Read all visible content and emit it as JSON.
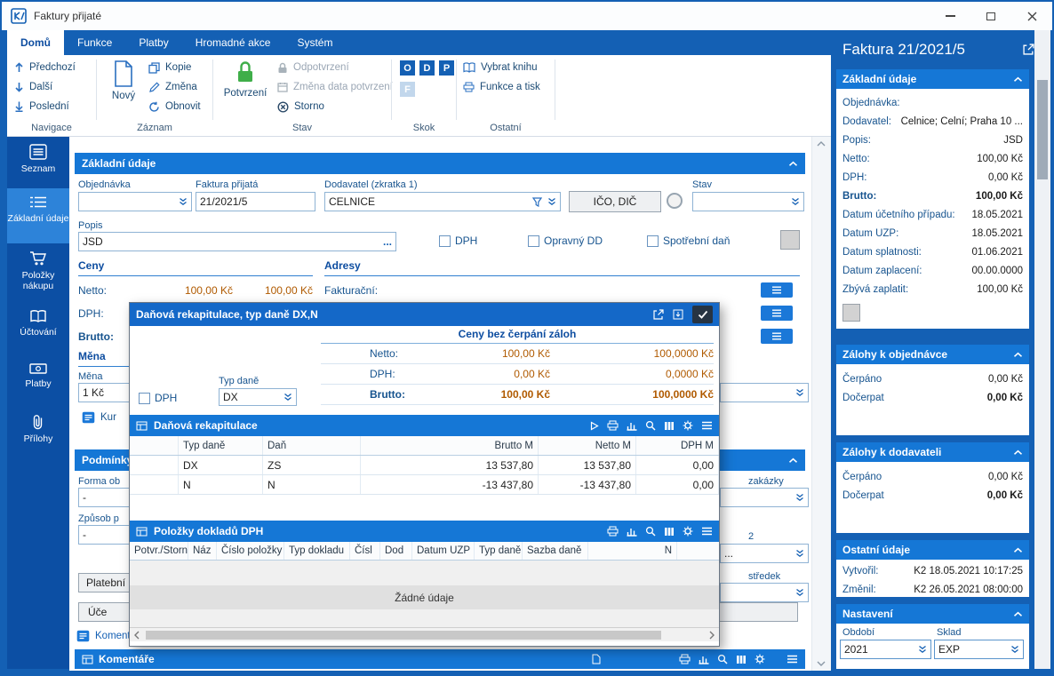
{
  "colors": {
    "accent": "#1460b4",
    "header_bar": "#1577d6",
    "sidebar": "#0c4fa4",
    "sidebar_active": "#2d83d9",
    "currency_text": "#b05a00",
    "confirm_lock_green": "#3fae49"
  },
  "window": {
    "title": "Faktury přijaté"
  },
  "tabs": [
    {
      "label": "Domů"
    },
    {
      "label": "Funkce"
    },
    {
      "label": "Platby"
    },
    {
      "label": "Hromadné akce"
    },
    {
      "label": "Systém"
    }
  ],
  "ribbon": {
    "groups": {
      "navigace": {
        "label": "Navigace",
        "prev": "Předchozí",
        "next": "Další",
        "last": "Poslední"
      },
      "zaznam": {
        "label": "Záznam",
        "new": "Nový",
        "copy": "Kopie",
        "edit": "Změna",
        "refresh": "Obnovit"
      },
      "stav": {
        "label": "Stav",
        "confirm": "Potvrzení",
        "unconfirm": "Odpotvrzení",
        "change_date": "Změna data potvrzení",
        "cancel": "Storno"
      },
      "skok": {
        "label": "Skok",
        "o": "O",
        "d": "D",
        "p": "P",
        "f": "F"
      },
      "ostatni": {
        "label": "Ostatní",
        "select_book": "Vybrat knihu",
        "func_print": "Funkce a tisk"
      }
    }
  },
  "sidebar": {
    "items": [
      {
        "label": "Seznam"
      },
      {
        "label": "Základní údaje"
      },
      {
        "label": "Položky nákupu"
      },
      {
        "label": "Účtování"
      },
      {
        "label": "Platby"
      },
      {
        "label": "Přílohy"
      }
    ]
  },
  "form": {
    "section_title": "Základní údaje",
    "objednavka_label": "Objednávka",
    "faktura_label": "Faktura přijatá",
    "faktura_value": "21/2021/5",
    "dodavatel_label": "Dodavatel (zkratka 1)",
    "dodavatel_value": "CELNICE",
    "ico_dic": "IČO, DIČ",
    "stav_label": "Stav",
    "popis_label": "Popis",
    "popis_value": "JSD",
    "popis_more": "...",
    "chk_dph": "DPH",
    "chk_opravny": "Opravný DD",
    "chk_spotrebni": "Spotřební daň",
    "ceny": "Ceny",
    "adresy": "Adresy",
    "netto_label": "Netto:",
    "netto_v1": "100,00 Kč",
    "netto_v2": "100,00 Kč",
    "fakturacni": "Fakturační:",
    "dph_label": "DPH:",
    "brutto_label": "Brutto:",
    "mena_header": "Měna",
    "mena_label": "Měna",
    "mena_value": "1 Kč",
    "kur": "Kur",
    "podminky": "Podmínky",
    "forma_label": "Forma ob",
    "forma_value": "-",
    "zpusob_label": "Způsob p",
    "zpusob_value": "-",
    "platebni": "Platební p",
    "ucet": "Úče",
    "komentar": "Komentář",
    "komentare": "Komentáře",
    "frag_zakazky": "zakázky",
    "frag_2": "2",
    "frag_stredisko": "středek",
    "frag_dots": "..."
  },
  "modal": {
    "title": "Daňová rekapitulace, typ daně DX,N",
    "summary_title": "Ceny bez čerpání záloh",
    "rows": [
      {
        "label": "Netto:",
        "v1": "100,00 Kč",
        "v2": "100,0000 Kč"
      },
      {
        "label": "DPH:",
        "v1": "0,00 Kč",
        "v2": "0,0000 Kč"
      },
      {
        "label": "Brutto:",
        "v1": "100,00 Kč",
        "v2": "100,0000 Kč"
      }
    ],
    "dph_chk": "DPH",
    "typ_dane_label": "Typ daně",
    "typ_dane_value": "DX",
    "rekap": {
      "title": "Daňová rekapitulace",
      "columns": [
        "Typ daně",
        "Daň",
        "Brutto M",
        "Netto M",
        "DPH M"
      ],
      "rows": [
        [
          "DX",
          "ZS",
          "13 537,80",
          "13 537,80",
          "0,00"
        ],
        [
          "N",
          "N",
          "-13 437,80",
          "-13 437,80",
          "0,00"
        ]
      ]
    },
    "polozky": {
      "title": "Položky dokladů DPH",
      "columns": [
        "Potvr./Storno",
        "Náz",
        "Číslo položky",
        "Typ dokladu",
        "Čísl",
        "Dod",
        "Datum UZP",
        "Typ daně",
        "Sazba daně",
        "N"
      ],
      "empty": "Žádné údaje"
    }
  },
  "panel": {
    "title": "Faktura 21/2021/5",
    "zakladni": {
      "header": "Základní údaje",
      "rows": [
        {
          "label": "Objednávka:",
          "value": ""
        },
        {
          "label": "Dodavatel:",
          "value": "Celnice; Celní; Praha 10 ..."
        },
        {
          "label": "Popis:",
          "value": "JSD"
        },
        {
          "label": "Netto:",
          "value": "100,00 Kč"
        },
        {
          "label": "DPH:",
          "value": "0,00 Kč"
        },
        {
          "label": "Brutto:",
          "value": "100,00 Kč"
        },
        {
          "label": "Datum účetního případu:",
          "value": "18.05.2021"
        },
        {
          "label": "Datum UZP:",
          "value": "18.05.2021"
        },
        {
          "label": "Datum splatnosti:",
          "value": "01.06.2021"
        },
        {
          "label": "Datum zaplacení:",
          "value": "00.00.0000"
        },
        {
          "label": "Zbývá zaplatit:",
          "value": "100,00 Kč"
        }
      ]
    },
    "zalohy_objednavce": {
      "header": "Zálohy k objednávce",
      "cerpano_label": "Čerpáno",
      "cerpano_value": "0,00 Kč",
      "docerpat_label": "Dočerpat",
      "docerpat_value": "0,00 Kč"
    },
    "zalohy_dodavateli": {
      "header": "Zálohy k dodavateli",
      "cerpano_label": "Čerpáno",
      "cerpano_value": "0,00 Kč",
      "docerpat_label": "Dočerpat",
      "docerpat_value": "0,00 Kč"
    },
    "ostatni": {
      "header": "Ostatní údaje",
      "vytvoril_label": "Vytvořil:",
      "vytvoril_value": "K2 18.05.2021 10:17:25",
      "zmenil_label": "Změnil:",
      "zmenil_value": "K2 26.05.2021 08:00:00"
    },
    "nastaveni": {
      "header": "Nastavení",
      "obdobi_label": "Období",
      "obdobi_value": "2021",
      "sklad_label": "Sklad",
      "sklad_value": "EXP"
    }
  }
}
